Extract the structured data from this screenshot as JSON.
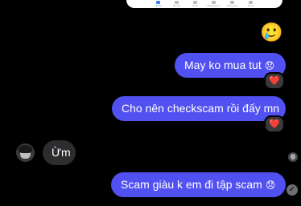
{
  "shared_image": {
    "tabs": [
      {
        "label": "Home",
        "icon": "home-icon",
        "active": true
      },
      {
        "label": "Bundle",
        "icon": "bundle-icon",
        "active": false
      },
      {
        "label": "News",
        "icon": "news-icon",
        "active": false
      },
      {
        "label": "Marketplace",
        "icon": "marketplace-icon",
        "active": false
      },
      {
        "label": "Thông báo",
        "icon": "bell-icon",
        "active": false
      },
      {
        "label": "Menu",
        "icon": "menu-icon",
        "active": false
      }
    ]
  },
  "messages": [
    {
      "id": "m1",
      "direction": "out",
      "emoji": "🥲"
    },
    {
      "id": "m2",
      "direction": "out",
      "text": "May ko mua tut",
      "suffix": "😞",
      "reaction": "❤️"
    },
    {
      "id": "m3",
      "direction": "out",
      "text": "Cho nên checkscam rồi đấy mn",
      "reaction": "❤️"
    },
    {
      "id": "m4",
      "direction": "in",
      "text": "Ừm"
    },
    {
      "id": "m5",
      "direction": "out",
      "text": "Scam giàu k em đi tập scam",
      "suffix": "😞"
    }
  ],
  "receipts": {
    "sent_check": "✓"
  },
  "colors": {
    "background": "#000000",
    "outgoing_bubble": "#5150f1",
    "incoming_bubble": "#2d2d30",
    "reaction_badge": "#3a3a3c",
    "heart": "#ff2f48"
  }
}
